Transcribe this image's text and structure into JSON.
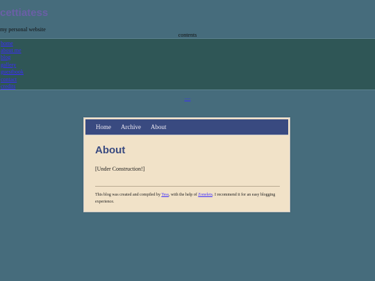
{
  "site": {
    "title": "cettiatess",
    "tagline": "my personal website",
    "contents_label": "contents"
  },
  "sidebar": {
    "items": [
      {
        "label": "home"
      },
      {
        "label": "about me"
      },
      {
        "label": "blog"
      },
      {
        "label": "gallery"
      },
      {
        "label": "guestbook"
      },
      {
        "label": "contact"
      },
      {
        "label": "credits"
      }
    ]
  },
  "small_link": "====",
  "blog": {
    "nav": {
      "home": "Home",
      "archive": "Archive",
      "about": "About"
    },
    "post": {
      "title": "About",
      "body": "[Under Construction!]"
    },
    "footer": {
      "prefix": "This blog was created and compiled by ",
      "author": "Tess",
      "middle": ", with the help of ",
      "tool": "Zonelets",
      "suffix": ". I recommend it for an easy blogging experience."
    }
  },
  "colors": {
    "page_background": "#466c7c",
    "nav_background": "#2f5656",
    "link": "#3b2bff",
    "site_title": "#6a5fa6",
    "blog_nav": "#394a80",
    "blog_panel": "#f1e2c8"
  }
}
